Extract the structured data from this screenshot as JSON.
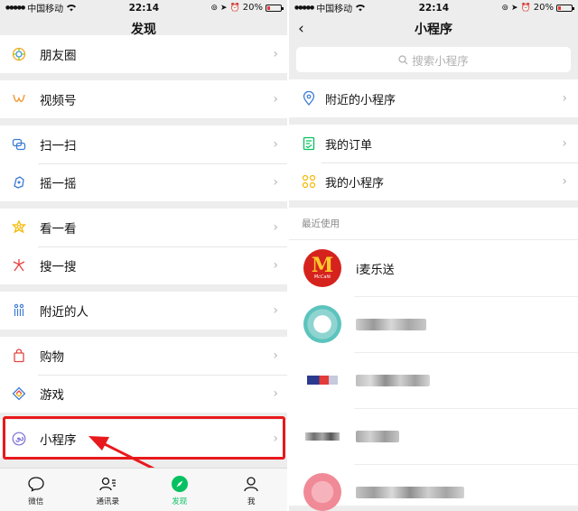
{
  "status_bar": {
    "carrier": "中国移动",
    "time": "22:14",
    "battery": "20%"
  },
  "discover": {
    "title": "发现",
    "groups": [
      [
        {
          "label": "朋友圈",
          "icon": "moments-icon"
        }
      ],
      [
        {
          "label": "视频号",
          "icon": "channels-icon"
        }
      ],
      [
        {
          "label": "扫一扫",
          "icon": "scan-icon"
        },
        {
          "label": "摇一摇",
          "icon": "shake-icon"
        }
      ],
      [
        {
          "label": "看一看",
          "icon": "top-stories-icon"
        },
        {
          "label": "搜一搜",
          "icon": "search-icon"
        }
      ],
      [
        {
          "label": "附近的人",
          "icon": "people-nearby-icon"
        }
      ],
      [
        {
          "label": "购物",
          "icon": "shopping-icon"
        },
        {
          "label": "游戏",
          "icon": "games-icon"
        }
      ],
      [
        {
          "label": "小程序",
          "icon": "mini-program-icon"
        }
      ]
    ],
    "tabs": [
      {
        "label": "微信",
        "icon": "chat-icon",
        "active": false
      },
      {
        "label": "通讯录",
        "icon": "contacts-icon",
        "active": false
      },
      {
        "label": "发现",
        "icon": "compass-icon",
        "active": true
      },
      {
        "label": "我",
        "icon": "me-icon",
        "active": false
      }
    ]
  },
  "mini_programs": {
    "title": "小程序",
    "search_placeholder": "搜索小程序",
    "nearby": {
      "label": "附近的小程序",
      "icon": "location-pin-icon"
    },
    "orders": {
      "label": "我的订单",
      "icon": "order-icon"
    },
    "mine": {
      "label": "我的小程序",
      "icon": "grid-icon"
    },
    "recent_header": "最近使用",
    "recent": [
      {
        "name": "i麦乐送",
        "logo": "mcdonalds-logo"
      },
      {
        "name": "",
        "logo": "blurred-logo"
      },
      {
        "name": "",
        "logo": "blurred-logo"
      },
      {
        "name": "",
        "logo": "blurred-logo"
      },
      {
        "name": "",
        "logo": "blurred-logo"
      }
    ]
  },
  "colors": {
    "accent": "#07c160",
    "highlight": "#e8191c",
    "background": "#ededed"
  }
}
